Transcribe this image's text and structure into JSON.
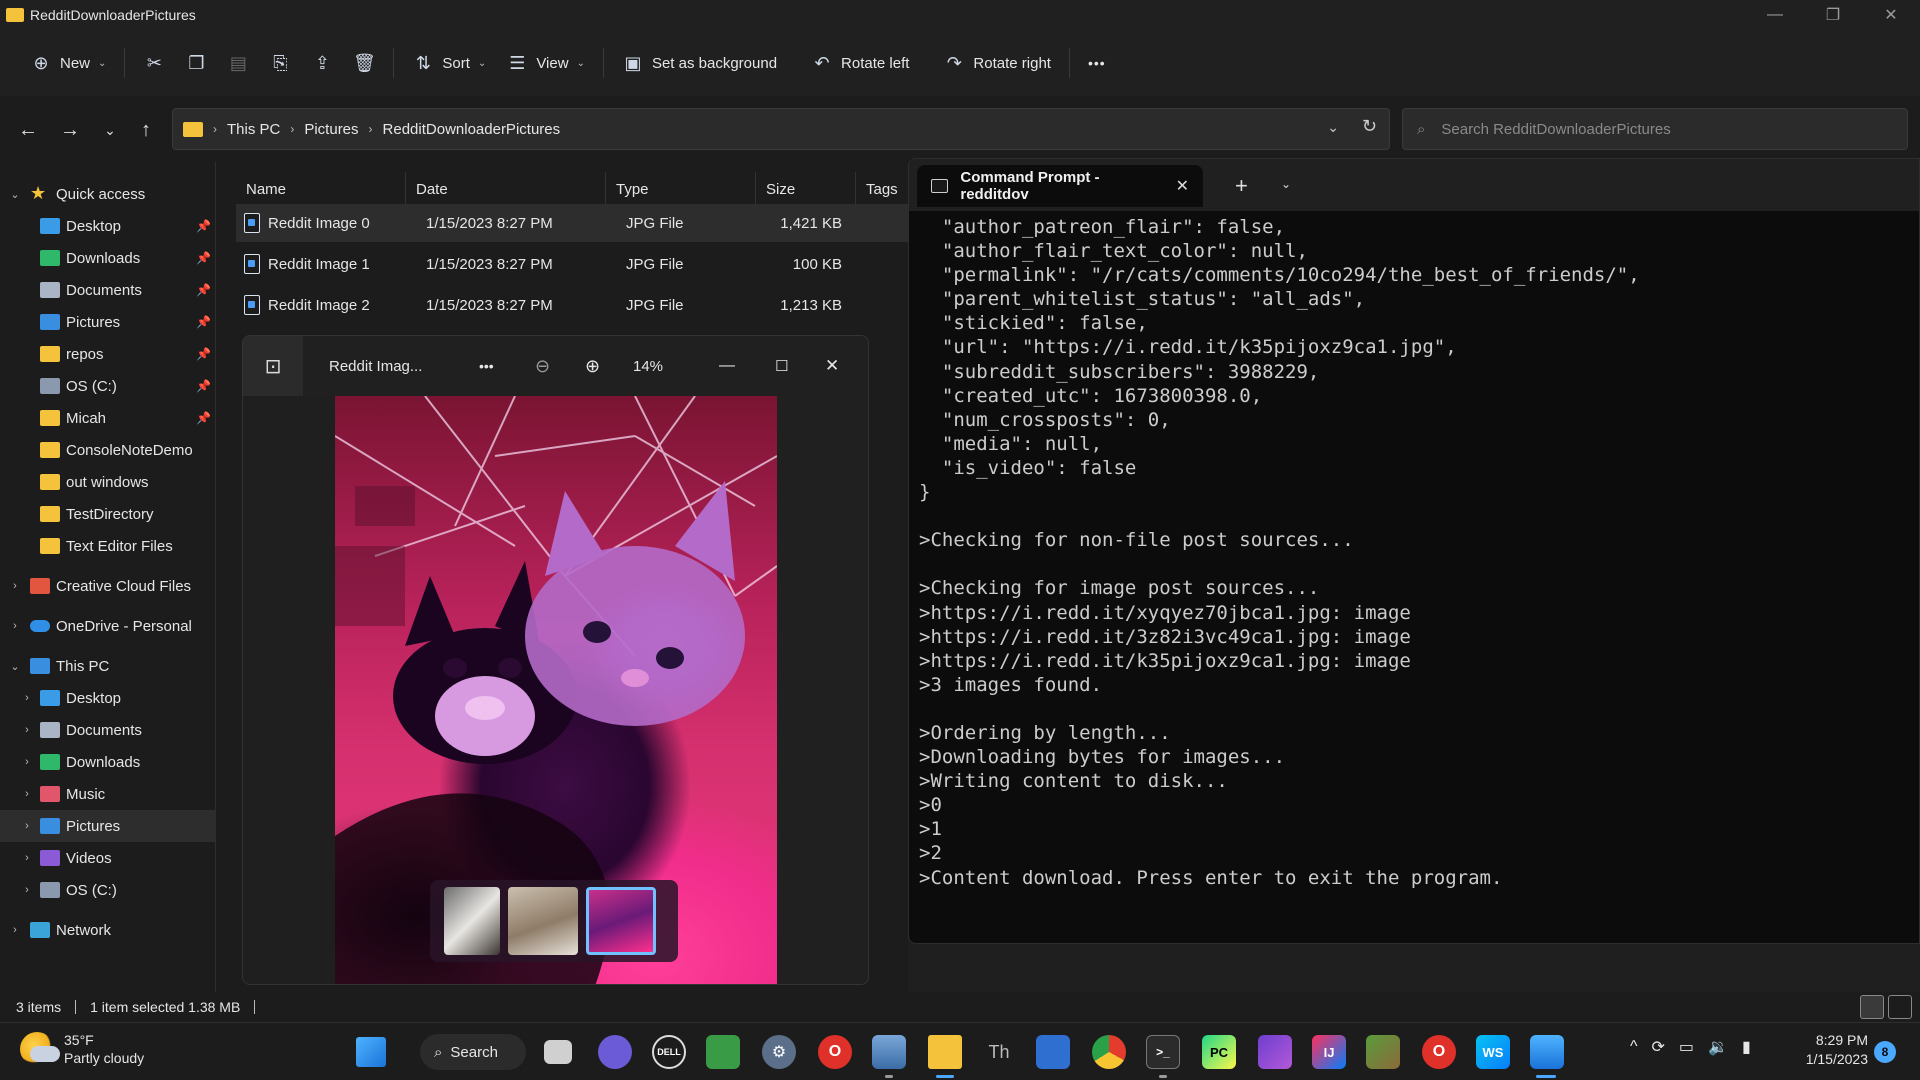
{
  "window": {
    "title": "RedditDownloaderPictures",
    "controls": [
      "—",
      "❐",
      "✕"
    ]
  },
  "toolbar": {
    "new_label": "New",
    "sort_label": "Sort",
    "view_label": "View",
    "set_background_label": "Set as background",
    "rotate_left_label": "Rotate left",
    "rotate_right_label": "Rotate right",
    "more_label": "•••"
  },
  "address": {
    "crumbs": [
      "This PC",
      "Pictures",
      "RedditDownloaderPictures"
    ]
  },
  "search": {
    "placeholder": "Search RedditDownloaderPictures"
  },
  "nav": {
    "quick_access": "Quick access",
    "quick_items": [
      {
        "label": "Desktop",
        "icon": "desktop-icon",
        "pinned": true
      },
      {
        "label": "Downloads",
        "icon": "download-icon",
        "pinned": true
      },
      {
        "label": "Documents",
        "icon": "documents-icon",
        "pinned": true
      },
      {
        "label": "Pictures",
        "icon": "pictures-icon",
        "pinned": true
      },
      {
        "label": "repos",
        "icon": "folder-icon",
        "pinned": true
      },
      {
        "label": "OS (C:)",
        "icon": "drive-icon",
        "pinned": true
      },
      {
        "label": "Micah",
        "icon": "folder-icon",
        "pinned": true
      },
      {
        "label": "ConsoleNoteDemo",
        "icon": "folder-icon",
        "pinned": false
      },
      {
        "label": "out windows",
        "icon": "folder-icon",
        "pinned": false
      },
      {
        "label": "TestDirectory",
        "icon": "folder-icon",
        "pinned": false
      },
      {
        "label": "Text Editor Files",
        "icon": "folder-icon",
        "pinned": false
      }
    ],
    "creative_cloud": "Creative Cloud Files",
    "onedrive": "OneDrive - Personal",
    "this_pc": "This PC",
    "pc_items": [
      {
        "label": "Desktop",
        "icon": "desktop-icon"
      },
      {
        "label": "Documents",
        "icon": "documents-icon"
      },
      {
        "label": "Downloads",
        "icon": "download-icon"
      },
      {
        "label": "Music",
        "icon": "music-icon"
      },
      {
        "label": "Pictures",
        "icon": "pictures-icon"
      },
      {
        "label": "Videos",
        "icon": "videos-icon"
      },
      {
        "label": "OS (C:)",
        "icon": "drive-icon"
      }
    ],
    "network": "Network"
  },
  "files": {
    "columns": [
      "Name",
      "Date",
      "Type",
      "Size",
      "Tags"
    ],
    "rows": [
      {
        "name": "Reddit Image 0",
        "date": "1/15/2023 8:27 PM",
        "type": "JPG File",
        "size": "1,421 KB"
      },
      {
        "name": "Reddit Image 1",
        "date": "1/15/2023 8:27 PM",
        "type": "JPG File",
        "size": "100 KB"
      },
      {
        "name": "Reddit Image 2",
        "date": "1/15/2023 8:27 PM",
        "type": "JPG File",
        "size": "1,213 KB"
      }
    ]
  },
  "viewer": {
    "title": "Reddit Imag...",
    "zoom": "14%"
  },
  "terminal": {
    "tab_title": "Command Prompt - redditdov",
    "lines": [
      "  \"author_patreon_flair\": false,",
      "  \"author_flair_text_color\": null,",
      "  \"permalink\": \"/r/cats/comments/10co294/the_best_of_friends/\",",
      "  \"parent_whitelist_status\": \"all_ads\",",
      "  \"stickied\": false,",
      "  \"url\": \"https://i.redd.it/k35pijoxz9ca1.jpg\",",
      "  \"subreddit_subscribers\": 3988229,",
      "  \"created_utc\": 1673800398.0,",
      "  \"num_crossposts\": 0,",
      "  \"media\": null,",
      "  \"is_video\": false",
      "}",
      "",
      ">Checking for non-file post sources...",
      "",
      ">Checking for image post sources...",
      ">https://i.redd.it/xyqyez70jbca1.jpg: image",
      ">https://i.redd.it/3z82i3vc49ca1.jpg: image",
      ">https://i.redd.it/k35pijoxz9ca1.jpg: image",
      ">3 images found.",
      "",
      ">Ordering by length...",
      ">Downloading bytes for images...",
      ">Writing content to disk...",
      ">0",
      ">1",
      ">2",
      ">Content download. Press enter to exit the program."
    ]
  },
  "status": {
    "items": "3 items",
    "selected": "1 item selected  1.38 MB"
  },
  "taskbar": {
    "temp": "35°F",
    "weather": "Partly cloudy",
    "search_label": "Search",
    "time": "8:29 PM",
    "date": "1/15/2023",
    "notifications": "8"
  }
}
